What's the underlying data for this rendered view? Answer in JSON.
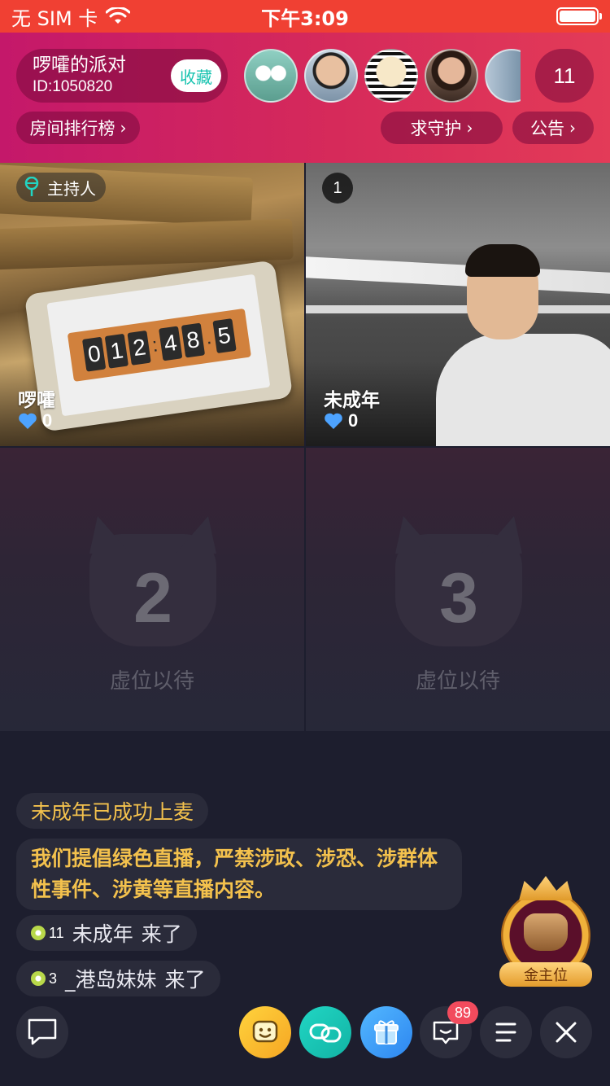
{
  "status_bar": {
    "carrier": "无 SIM 卡",
    "time": "下午3:09",
    "battery_level": 1.0
  },
  "room": {
    "name": "啰嚯的派对",
    "id_text": "ID:1050820",
    "favorite_label": "收藏",
    "online_count": "11"
  },
  "header_chips": {
    "rank_label": "房间排行榜",
    "guard_label": "求守护",
    "notice_label": "公告",
    "chevron": "›"
  },
  "seats": {
    "host": {
      "tag_label": "主持人",
      "name": "啰嚯",
      "likes": "0",
      "timer_digits": [
        "0",
        "1",
        "2",
        "4",
        "8",
        "5"
      ]
    },
    "seat1": {
      "number": "1",
      "name": "未成年",
      "likes": "0"
    },
    "seat2": {
      "number": "2",
      "label": "虚位以待"
    },
    "seat3": {
      "number": "3",
      "label": "虚位以待"
    }
  },
  "chat": {
    "system_msg": "未成年已成功上麦",
    "notice_msg": "我们提倡绿色直播，严禁涉政、涉恐、涉群体性事件、涉黄等直播内容。",
    "joins": [
      {
        "level": "11",
        "name": "未成年",
        "action": "来了"
      },
      {
        "level": "3",
        "name": "_港岛妹妹",
        "action": "来了"
      }
    ]
  },
  "gold_seat": {
    "label": "金主位"
  },
  "toolbar": {
    "message_badge": "89"
  },
  "colors": {
    "status_bar": "#f04033",
    "header_gradient_start": "#c4186a",
    "header_gradient_end": "#e33b58",
    "favorite_text": "#18c3b0",
    "chat_highlight": "#f3c14d",
    "badge_red": "#f24b5d",
    "like_heart": "#4da3ff"
  }
}
